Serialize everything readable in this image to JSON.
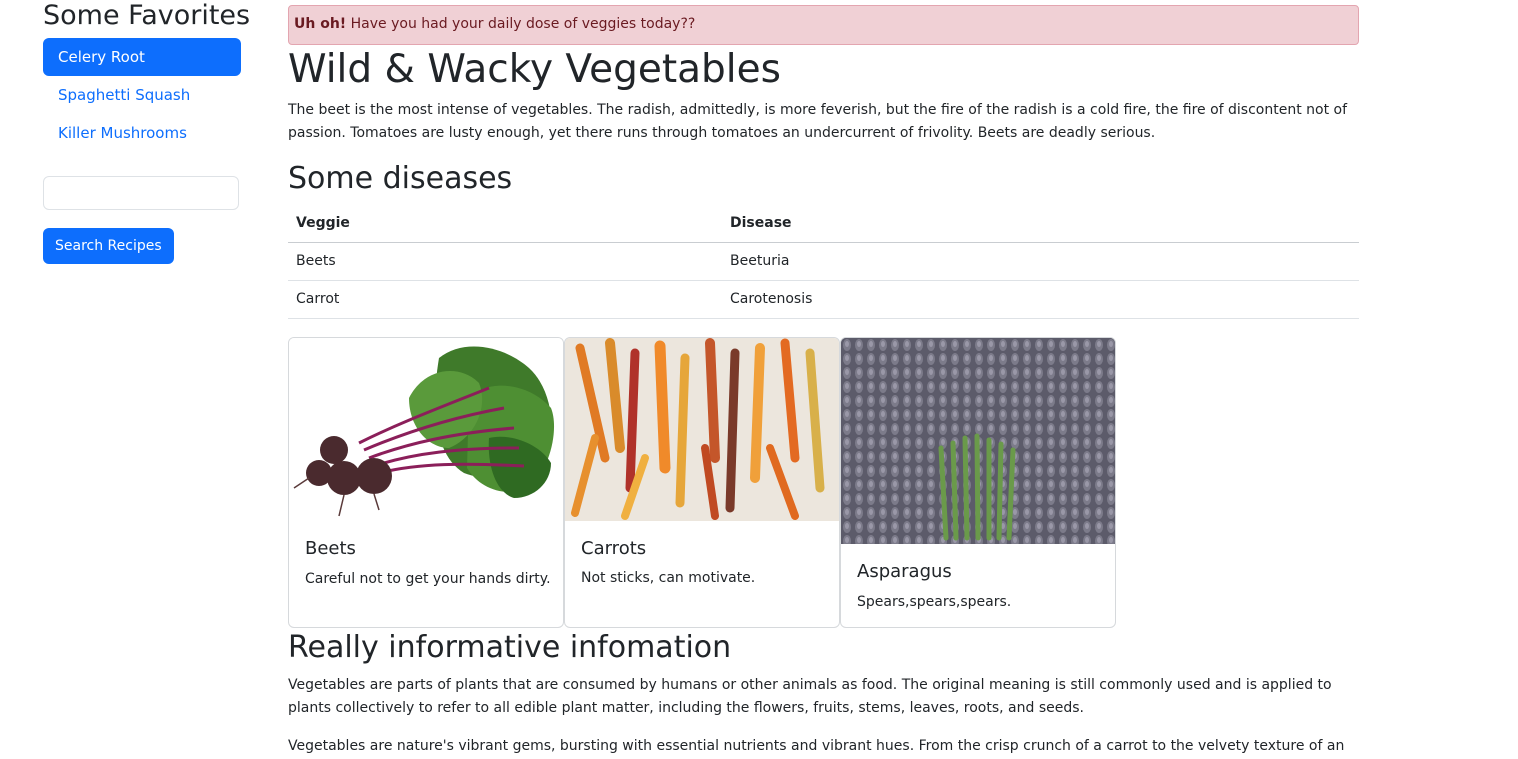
{
  "sidebar": {
    "title": "Some Favorites",
    "items": [
      {
        "label": "Celery Root",
        "active": true
      },
      {
        "label": "Spaghetti Squash",
        "active": false
      },
      {
        "label": "Killer Mushrooms",
        "active": false
      }
    ],
    "search": {
      "value": "",
      "placeholder": ""
    },
    "search_button": "Search Recipes"
  },
  "alert": {
    "strong": "Uh oh!",
    "text": " Have you had your daily dose of veggies today??"
  },
  "main": {
    "title": "Wild & Wacky Vegetables",
    "intro": "The beet is the most intense of vegetables. The radish, admittedly, is more feverish, but the fire of the radish is a cold fire, the fire of discontent not of passion. Tomatoes are lusty enough, yet there runs through tomatoes an undercurrent of frivolity. Beets are deadly serious.",
    "diseases_heading": "Some diseases",
    "table": {
      "headers": [
        "Veggie",
        "Disease"
      ],
      "rows": [
        [
          "Beets",
          "Beeturia"
        ],
        [
          "Carrot",
          "Carotenosis"
        ]
      ]
    },
    "cards": [
      {
        "title": "Beets",
        "text": "Careful not to get your hands dirty.",
        "image": "beets-photo"
      },
      {
        "title": "Carrots",
        "text": "Not sticks, can motivate.",
        "image": "carrots-photo"
      },
      {
        "title": "Asparagus",
        "text": "Spears,spears,spears.",
        "image": "asparagus-photo"
      }
    ],
    "info_heading": "Really informative infomation",
    "paragraphs": [
      "Vegetables are parts of plants that are consumed by humans or other animals as food. The original meaning is still commonly used and is applied to plants collectively to refer to all edible plant matter, including the flowers, fruits, stems, leaves, roots, and seeds.",
      "Vegetables are nature's vibrant gems, bursting with essential nutrients and vibrant hues. From the crisp crunch of a carrot to the velvety texture of an"
    ]
  },
  "colors": {
    "primary": "#0d6efd",
    "alert_bg": "#f0d0d5",
    "alert_text": "#6a1a21"
  }
}
